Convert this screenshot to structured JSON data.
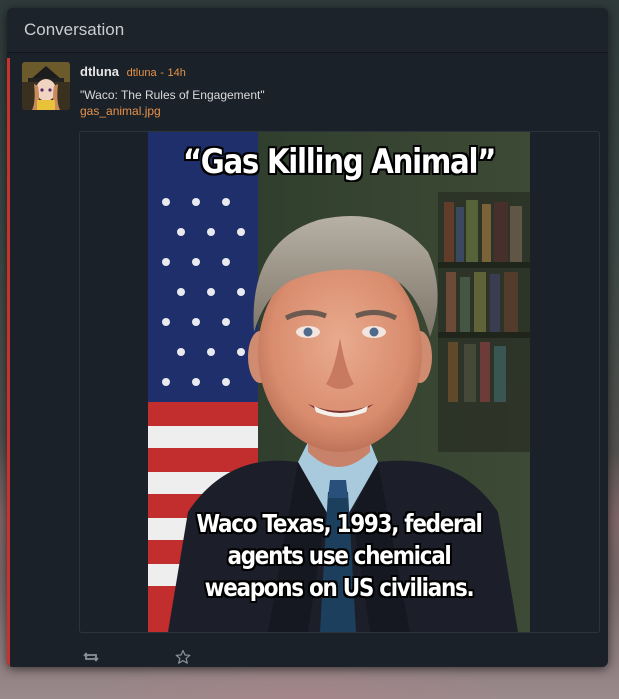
{
  "panel": {
    "title": "Conversation"
  },
  "notice": {
    "author_name": "dtluna",
    "author_handle": "dtluna",
    "separator": "-",
    "time": "14h",
    "text": "\"Waco: The Rules of Engagement\"",
    "attachment_name": "gas_animal.jpg",
    "attachment": {
      "caption_top": "“Gas Killing Animal”",
      "caption_bottom": "Waco Texas, 1993, federal\nagents use chemical\nweapons on US civilians."
    },
    "actions": {
      "repeat_icon": "retweet-icon",
      "favorite_icon": "star-icon"
    }
  },
  "colors": {
    "accent": "#e8924a",
    "highlight_border": "#c8312c",
    "panel_bg": "#1a2128"
  }
}
